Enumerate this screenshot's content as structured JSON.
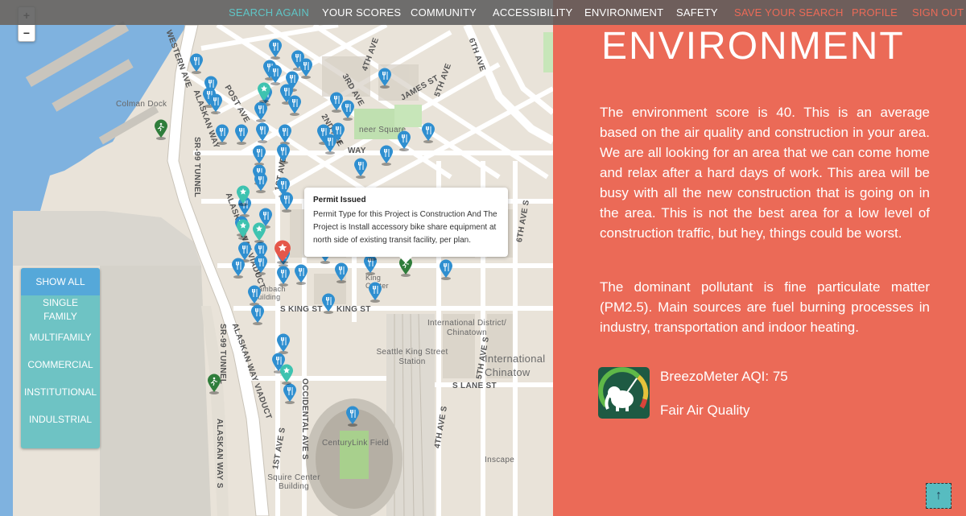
{
  "nav": {
    "items": [
      {
        "label": "SEARCH AGAIN",
        "style": "teal"
      },
      {
        "label": "YOUR SCORES",
        "style": "white"
      },
      {
        "label": "COMMUNITY",
        "style": "white"
      },
      {
        "label": "ACCESSIBILITY",
        "style": "white"
      },
      {
        "label": "ENVIRONMENT",
        "style": "white"
      },
      {
        "label": "SAFETY",
        "style": "white"
      },
      {
        "label": "SAVE YOUR SEARCH",
        "style": "coral"
      },
      {
        "label": "PROFILE",
        "style": "coral"
      },
      {
        "label": "SIGN OUT",
        "style": "coral"
      }
    ]
  },
  "map": {
    "zoom_in": "+",
    "zoom_out": "−",
    "popup": {
      "title": "Permit Issued",
      "body": "Permit Type for this Project is Construction And The Project is Install accessory bike share equipment at north side of existing transit facility, per plan."
    },
    "filters": [
      "SHOW ALL",
      "SINGLE FAMILY",
      "MULTIFAMILY",
      "COMMERCIAL",
      "INSTITUTIONAL",
      "INDULSTRIAL"
    ],
    "labels": {
      "western_ave": "WESTERN AVE",
      "alaskan_way": "ALASKAN WAY",
      "alaskan_way_viaduct": "ALASKAN WAY VIADUCT",
      "alaskan_way_viaduct_2": "ALASKAN WAY VIADUCT",
      "sr99_tunnel": "SR-99 TUNNEL",
      "sr99_tunnel_2": "SR-99 TUNNEL",
      "colman_dock": "Colman Dock",
      "post_ave": "POST AVE",
      "first_ave_s": "1ST AVE S",
      "first_ave_s_2": "1ST AVE S",
      "second_ave": "2ND AVE",
      "third_ave": "3RD AVE",
      "fourth_ave": "4TH AVE",
      "fifth_ave": "5TH AVE",
      "sixth_ave": "6TH AVE",
      "james_st": "JAMES ST",
      "pioneer_square": "neer Square",
      "way": "WAY",
      "s_king_st": "S KING ST",
      "king_st": "KING ST",
      "hambach": "Hambach Building",
      "king_center": "King Center",
      "intl_district": "International District/ Chinatown",
      "seattle_king_street": "Seattle King Street Station",
      "international_chinatown": "International Chinatow",
      "fourth_ave_s": "4TH AVE S",
      "fifth_ave_s": "5TH AVE S",
      "sixth_ave_s": "6TH AVE S",
      "s_lane_st": "S LANE ST",
      "occidental_ave_s": "OCCIDENTAL AVE S",
      "century_link": "CenturyLink Field",
      "squire_center": "Squire Center Building",
      "inscape": "Inscape",
      "alaskan_way_s": "ALASKAN WAY S"
    }
  },
  "panel": {
    "title": "ENVIRONMENT",
    "paragraph1": "The environment score is 40. This is an average based on the air quality and construction in your area. We are all looking for an area that we can come home and relax after a hard days of work. This area will be busy with all the new construction that is going on in the area. This is not the best area for a low level of construction traffic, but hey, things could be worst.",
    "paragraph2": "The dominant pollutant is fine particulate matter (PM2.5). Main sources are fuel burning processes in industry, transportation and indoor heating.",
    "aqi_label": "BreezoMeter AQI: 75",
    "quality_label": "Fair Air Quality",
    "scroll_top": "↑"
  },
  "colors": {
    "coral": "#eb6a57",
    "teal": "#5fc5c6",
    "pin_blue": "#2f8fd0",
    "pin_green": "#2f7d3b",
    "pin_teal": "#3ec3b0",
    "water": "#7fb2df"
  }
}
